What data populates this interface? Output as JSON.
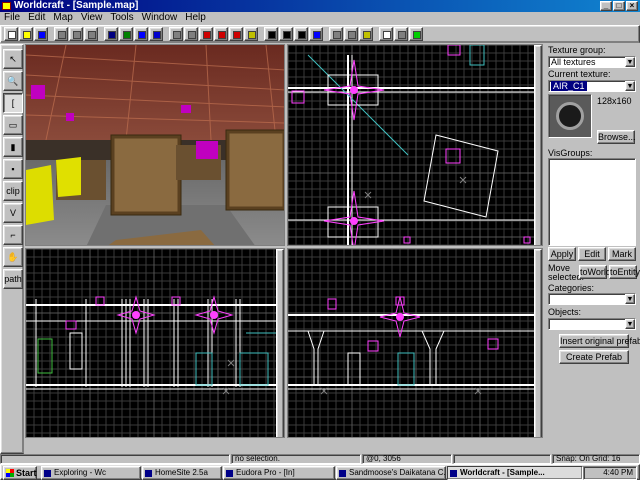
{
  "window": {
    "title": "Worldcraft - [Sample.map]"
  },
  "menu": [
    "File",
    "Edit",
    "Map",
    "View",
    "Tools",
    "Window",
    "Help"
  ],
  "toolbar": {
    "icons": [
      "new-icon",
      "open-icon",
      "save-icon",
      "grid-toggle-icon",
      "grid-smaller-icon",
      "grid-larger-icon",
      "view-3d-icon",
      "view-wireframe-icon",
      "view-flat-icon",
      "view-textured-icon",
      "group-icon",
      "ungroup-icon",
      "ignore-group-icon",
      "hide-icon",
      "show-icon",
      "texture-lock-icon",
      "cut-icon",
      "copy-icon",
      "paste-icon",
      "undo-icon",
      "carve-icon",
      "hollow-icon",
      "toggle-texture-icon",
      "select-all-icon",
      "snap-icon",
      "run-map-icon"
    ]
  },
  "palette": {
    "tools": [
      {
        "name": "selection-tool",
        "glyph": "↖"
      },
      {
        "name": "magnify-tool",
        "glyph": "🔍"
      },
      {
        "name": "camera-tool",
        "glyph": "["
      },
      {
        "name": "entity-tool",
        "glyph": "▭"
      },
      {
        "name": "block-tool",
        "glyph": "▮"
      },
      {
        "name": "texture-application-tool",
        "glyph": "▪"
      },
      {
        "name": "clipping-tool",
        "glyph": "clip"
      },
      {
        "name": "vertex-tool",
        "glyph": "V"
      },
      {
        "name": "apply-decal-tool",
        "glyph": "⌐"
      },
      {
        "name": "overlay-tool",
        "glyph": "✋"
      },
      {
        "name": "path-tool",
        "glyph": "path"
      }
    ]
  },
  "right_panel": {
    "texture_group_label": "Texture group:",
    "texture_group_value": "All textures",
    "current_texture_label": "Current texture:",
    "current_texture_value": "AIR_C1",
    "texture_size": "128x160",
    "browse_label": "Browse...",
    "visgroups_label": "VisGroups:",
    "apply_label": "Apply",
    "edit_label": "Edit",
    "mark_label": "Mark",
    "move_selected_label": "Move selected:",
    "to_world_label": "toWorld",
    "to_entity_label": "toEntity",
    "categories_label": "Categories:",
    "objects_label": "Objects:",
    "insert_prefab_label": "Insert original prefab",
    "create_prefab_label": "Create Prefab"
  },
  "status": {
    "selection": "no selection.",
    "coords": "@0, 3056",
    "snap": "Snap: On Grid: 16"
  },
  "taskbar": {
    "start_label": "Start",
    "tasks": [
      {
        "label": "Exploring - Wc"
      },
      {
        "label": "HomeSite 2.5a"
      },
      {
        "label": "Eudora Pro - [In]"
      },
      {
        "label": "Sandmoose's Daikatana C..."
      },
      {
        "label": "Worldcraft - [Sample..."
      }
    ],
    "clock": "4:40 PM"
  },
  "colors": {
    "grid": "#3a3a3a",
    "grid_major": "#555555",
    "brush_white": "#ffffff",
    "entity_magenta": "#ff40ff",
    "brush_cyan": "#40c0c0"
  }
}
